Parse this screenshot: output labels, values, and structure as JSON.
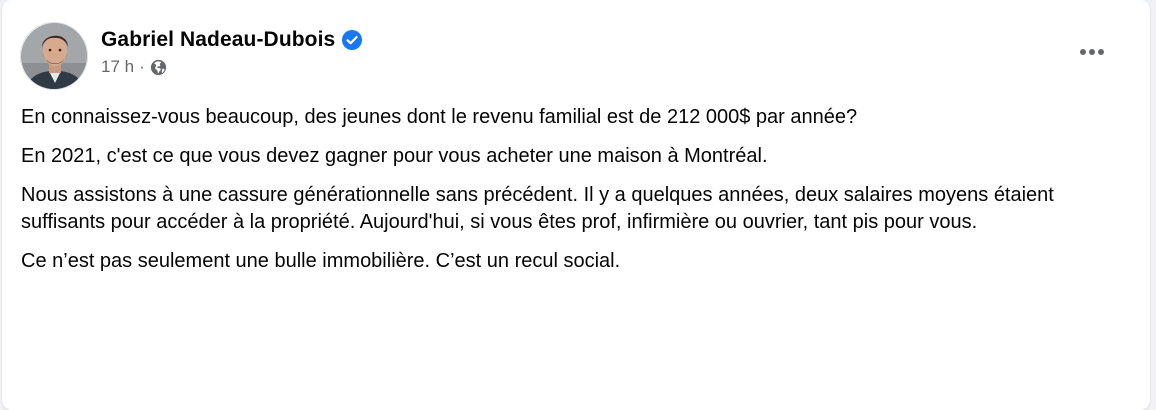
{
  "post": {
    "author": {
      "name": "Gabriel Nadeau-Dubois",
      "verified_icon": "verified-badge-icon",
      "avatar_icon": "profile-photo"
    },
    "timestamp": "17 h",
    "separator": "·",
    "audience_icon": "globe-icon",
    "menu_icon": "more-options-icon",
    "paragraphs": [
      "En connaissez-vous beaucoup, des jeunes dont le revenu familial est de 212 000$ par année?",
      "En 2021, c'est ce que vous devez gagner pour vous acheter une maison à Montréal.",
      "Nous assistons à une cassure générationnelle sans précédent. Il y a quelques années, deux salaires moyens étaient suffisants pour accéder à la propriété. Aujourd'hui, si vous êtes prof, infirmière ou ouvrier, tant pis pour vous.",
      "Ce n’est pas seulement une bulle immobilière. C’est un recul social."
    ]
  },
  "colors": {
    "verified_blue": "#1877f2",
    "text_primary": "#050505",
    "text_secondary": "#65676b"
  }
}
